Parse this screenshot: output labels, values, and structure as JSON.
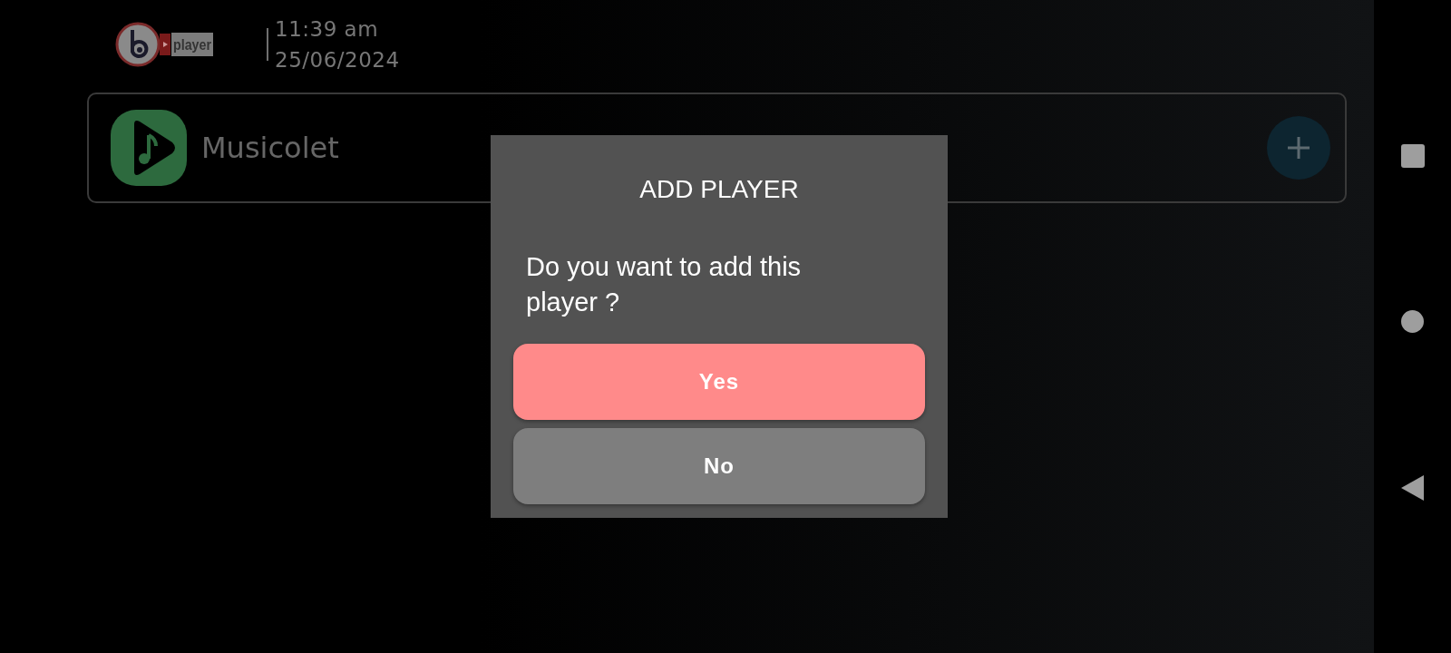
{
  "header": {
    "logo_text": "player",
    "time": "11:39 am",
    "date": "25/06/2024"
  },
  "players": [
    {
      "name": "Musicolet"
    }
  ],
  "dialog": {
    "title": "ADD PLAYER",
    "message": "Do you want to add this player ?",
    "buttons": [
      {
        "label": "Yes",
        "kind": "primary"
      },
      {
        "label": "No",
        "kind": "secondary"
      }
    ]
  }
}
